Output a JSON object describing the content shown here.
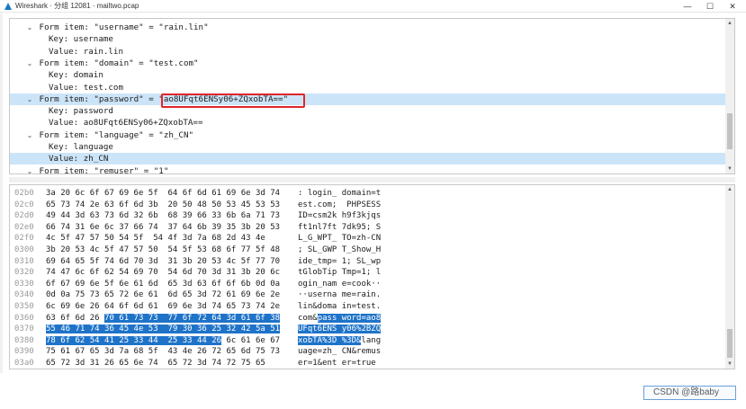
{
  "window": {
    "title": "Wireshark · 分组 12081 · mailtwo.pcap",
    "minimize": "—",
    "maximize": "☐",
    "close": "✕"
  },
  "details": {
    "rows": [
      {
        "arrow": "⌄",
        "text": "Form item: \"username\" = \"rain.lin\"",
        "indent": 0
      },
      {
        "arrow": "",
        "text": "Key: username",
        "indent": 1
      },
      {
        "arrow": "",
        "text": "Value: rain.lin",
        "indent": 1
      },
      {
        "arrow": "⌄",
        "text": "Form item: \"domain\" = \"test.com\"",
        "indent": 0
      },
      {
        "arrow": "",
        "text": "Key: domain",
        "indent": 1
      },
      {
        "arrow": "",
        "text": "Value: test.com",
        "indent": 1
      },
      {
        "arrow": "⌄",
        "text": "Form item: \"password\" = \"ao8UFqt6ENSy06+ZQxobTA==\"",
        "indent": 0
      },
      {
        "arrow": "",
        "text": "Key: password",
        "indent": 1
      },
      {
        "arrow": "",
        "text": "Value: ao8UFqt6ENSy06+ZQxobTA==",
        "indent": 1
      },
      {
        "arrow": "⌄",
        "text": "Form item: \"language\" = \"zh_CN\"",
        "indent": 0
      },
      {
        "arrow": "",
        "text": "Key: language",
        "indent": 1
      },
      {
        "arrow": "",
        "text": "Value: zh_CN",
        "indent": 1
      },
      {
        "arrow": "⌄",
        "text": "Form item: \"remuser\" = \"1\"",
        "indent": 0
      }
    ]
  },
  "bytes": {
    "rows": [
      {
        "offset": "02b0",
        "hex": "3a 20 6c 6f 67 69 6e 5f  64 6f 6d 61 69 6e 3d 74",
        "ascii": ": login_ domain=t"
      },
      {
        "offset": "02c0",
        "hex": "65 73 74 2e 63 6f 6d 3b  20 50 48 50 53 45 53 53",
        "ascii": "est.com;  PHPSESS"
      },
      {
        "offset": "02d0",
        "hex": "49 44 3d 63 73 6d 32 6b  68 39 66 33 6b 6a 71 73",
        "ascii": "ID=csm2k h9f3kjqs"
      },
      {
        "offset": "02e0",
        "hex": "66 74 31 6e 6c 37 66 74  37 64 6b 39 35 3b 20 53",
        "ascii": "ft1nl7ft 7dk95; S"
      },
      {
        "offset": "02f0",
        "hex": "4c 5f 47 57 50 54 5f  54 4f 3d 7a 68 2d 43 4e",
        "ascii": "L_G_WPT_ TO=zh-CN"
      },
      {
        "offset": "0300",
        "hex": "3b 20 53 4c 5f 47 57 50  54 5f 53 68 6f 77 5f 48",
        "ascii": "; SL_GWP T_Show_H"
      },
      {
        "offset": "0310",
        "hex": "69 64 65 5f 74 6d 70 3d  31 3b 20 53 4c 5f 77 70",
        "ascii": "ide_tmp= 1; SL_wp"
      },
      {
        "offset": "0320",
        "hex": "74 47 6c 6f 62 54 69 70  54 6d 70 3d 31 3b 20 6c",
        "ascii": "tGlobTip Tmp=1; l"
      },
      {
        "offset": "0330",
        "hex": "6f 67 69 6e 5f 6e 61 6d  65 3d 63 6f 6f 6b 0d 0a",
        "ascii": "ogin_nam e=cook··"
      },
      {
        "offset": "0340",
        "hex": "0d 0a 75 73 65 72 6e 61  6d 65 3d 72 61 69 6e 2e",
        "ascii": "··userna me=rain."
      },
      {
        "offset": "0350",
        "hex": "6c 69 6e 26 64 6f 6d 61  69 6e 3d 74 65 73 74 2e",
        "ascii": "lin&doma in=test."
      },
      {
        "offset": "0360",
        "hex_a": "63 6f 6d 26 ",
        "hex_b": "70 61 73 73  77 6f 72 64 3d 61 6f 38",
        "ascii_a": "com&",
        "ascii_b": "pass word=ao8"
      },
      {
        "offset": "0370",
        "hex_b": "55 46 71 74 36 45 4e 53  79 30 36 25 32 42 5a 51",
        "ascii_b": "UFqt6ENS y06%2BZQ"
      },
      {
        "offset": "0380",
        "hex_b": "78 6f 62 54 41 25 33 44  25 33 44 26",
        "hex_a": " 6c 61 6e 67",
        "ascii_b": "xobTA%3D %3D&",
        "ascii_a": "lang"
      },
      {
        "offset": "0390",
        "hex": "75 61 67 65 3d 7a 68 5f  43 4e 26 72 65 6d 75 73",
        "ascii": "uage=zh_ CN&remus"
      },
      {
        "offset": "03a0",
        "hex": "65 72 3d 31 26 65 6e 74  65 72 3d 74 72 75 65",
        "ascii": "er=1&ent er=true"
      }
    ]
  },
  "watermark": "CSDN @路baby",
  "colors": {
    "selection": "#cce4f7",
    "byte_highlight": "#1e73c9",
    "annotation_box": "#e0262b"
  }
}
